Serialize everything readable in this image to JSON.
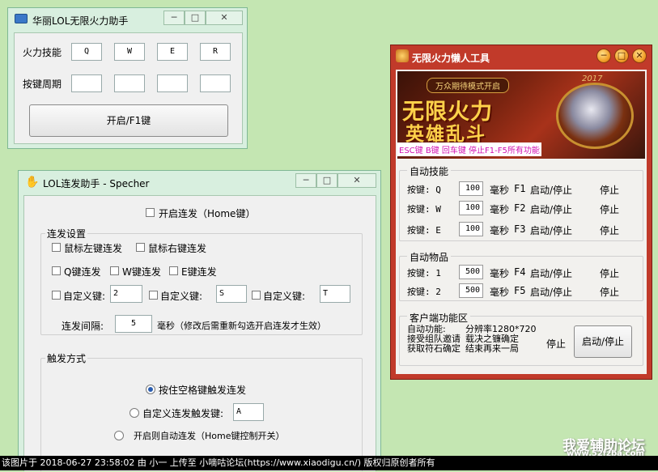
{
  "window1": {
    "title": "华丽LOL无限火力助手",
    "label_skill": "火力技能",
    "label_period": "按键周期",
    "keys": [
      "Q",
      "W",
      "E",
      "R"
    ],
    "periods": [
      "",
      "",
      "",
      ""
    ],
    "start_button": "开启/F1键",
    "controls": {
      "min": "─",
      "max": "□",
      "close": "✕"
    }
  },
  "window2": {
    "title": "LOL连发助手 - Specher",
    "enable_label": "开启连发（Home键）",
    "group_settings": "连发设置",
    "mouse_left": "鼠标左键连发",
    "mouse_right": "鼠标右键连发",
    "q_repeat": "Q键连发",
    "w_repeat": "W键连发",
    "e_repeat": "E键连发",
    "custom_key_label": "自定义键:",
    "custom_values": [
      "2",
      "S",
      "T"
    ],
    "interval_label": "连发间隔:",
    "interval_value": "5",
    "interval_unit": "毫秒（修改后需重新勾选开启连发才生效）",
    "group_trigger": "触发方式",
    "radio_space": "按住空格键触发连发",
    "radio_custom": "自定义连发触发键:",
    "radio_custom_value": "A",
    "radio_auto": "开启则自动连发（Home键控制开关）"
  },
  "window3": {
    "title": "无限火力懒人工具",
    "banner": {
      "tag": "万众期待模式开启",
      "line1": "无限火力",
      "line2": "英雄乱斗",
      "year": "2017",
      "hotkeys": "ESC键 B键 回车键 停止F1-F5所有功能"
    },
    "auto_skill_group": "自动技能",
    "skills": [
      {
        "key": "按键: Q",
        "value": "100",
        "unit": "毫秒",
        "fkey": "F1",
        "action": "启动/停止",
        "state": "停止"
      },
      {
        "key": "按键: W",
        "value": "100",
        "unit": "毫秒",
        "fkey": "F2",
        "action": "启动/停止",
        "state": "停止"
      },
      {
        "key": "按键: E",
        "value": "100",
        "unit": "毫秒",
        "fkey": "F3",
        "action": "启动/停止",
        "state": "停止"
      }
    ],
    "auto_item_group": "自动物品",
    "items": [
      {
        "key": "按键: 1",
        "value": "500",
        "unit": "毫秒",
        "fkey": "F4",
        "action": "启动/停止",
        "state": "停止"
      },
      {
        "key": "按键: 2",
        "value": "500",
        "unit": "毫秒",
        "fkey": "F5",
        "action": "启动/停止",
        "state": "停止"
      }
    ],
    "client_group": "客户端功能区",
    "client_line1": "自动功能:",
    "client_line1b": "分辨率1280*720",
    "client_line2": "接受组队邀请",
    "client_line2b": "载决之镰确定",
    "client_line3": "获取符石确定",
    "client_line3b": "结束再来一局",
    "client_state": "停止",
    "client_button": "启动/停止"
  },
  "watermark": {
    "line1": "我爱辅助论坛",
    "line2": "www.52fzba.com"
  },
  "footer": "该图片于 2018-06-27 23:58:02 由 小一 上传至 小嘀咕论坛(https://www.xiaodigu.cn/) 版权归原创者所有"
}
